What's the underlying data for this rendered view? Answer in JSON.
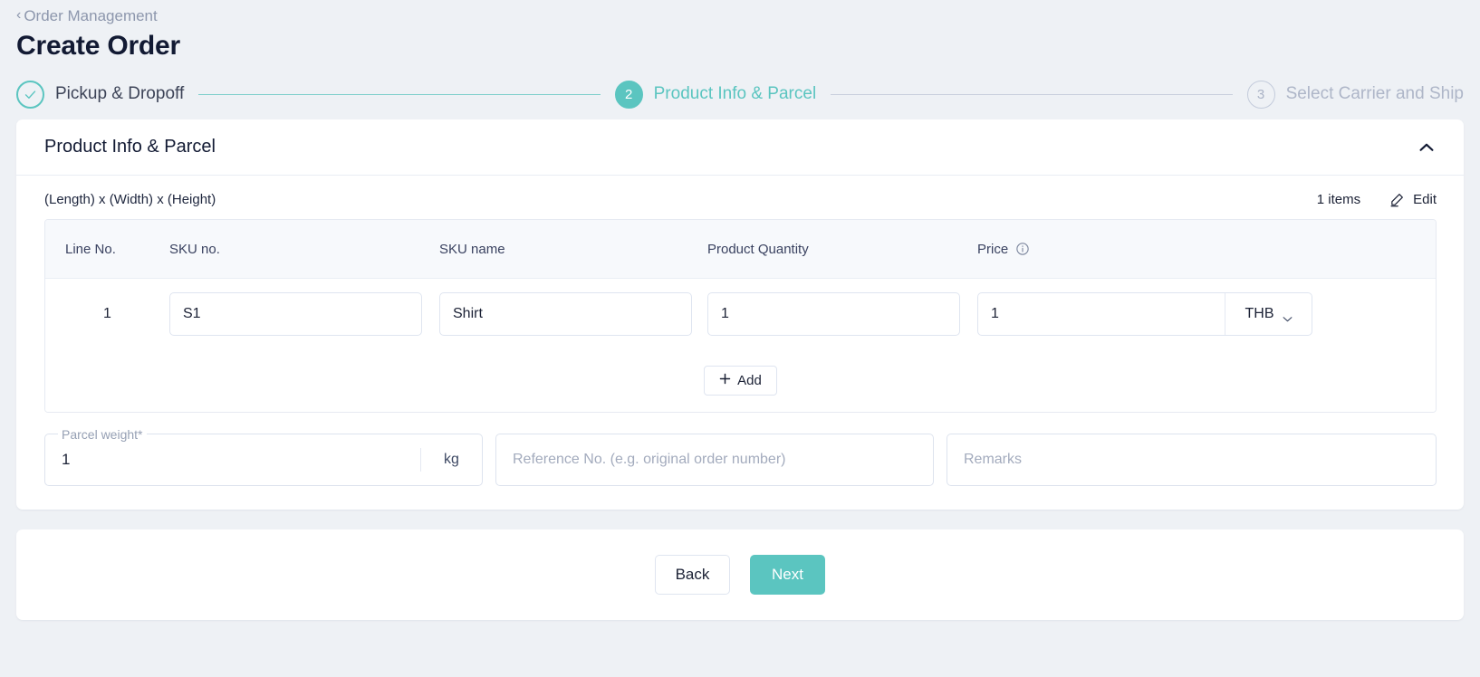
{
  "header": {
    "breadcrumb_label": "Order Management",
    "breadcrumb_icon": "chevron-left-icon",
    "page_title": "Create Order"
  },
  "stepper": {
    "steps": [
      {
        "number": "",
        "label": "Pickup & Dropoff",
        "state": "done",
        "icon": "check-icon"
      },
      {
        "number": "2",
        "label": "Product Info & Parcel",
        "state": "active"
      },
      {
        "number": "3",
        "label": "Select Carrier and Ship",
        "state": "todo"
      }
    ],
    "accent_color": "#5bc5c0",
    "inactive_color": "#aeb6c8"
  },
  "card": {
    "title": "Product Info & Parcel",
    "collapse_icon": "chevron-up-icon",
    "dimensions_label": "(Length) x (Width) x (Height)",
    "items_count": "1 items",
    "edit_label": "Edit",
    "edit_icon": "pencil-icon"
  },
  "table": {
    "columns": [
      "Line No.",
      "SKU no.",
      "SKU name",
      "Product Quantity",
      "Price"
    ],
    "price_info_icon": "info-circle-icon",
    "rows": [
      {
        "line_no": "1",
        "sku_no": "S1",
        "sku_name": "Shirt",
        "quantity": "1",
        "price": "1",
        "currency": "THB",
        "currency_caret_icon": "chevron-down-icon"
      }
    ],
    "add_label": "Add",
    "add_icon": "plus-icon"
  },
  "fields": {
    "parcel_weight": {
      "label": "Parcel weight",
      "required_marker": "*",
      "value": "1",
      "unit": "kg"
    },
    "reference_no": {
      "placeholder": "Reference No. (e.g. original order number)",
      "value": ""
    },
    "remarks": {
      "placeholder": "Remarks",
      "value": ""
    }
  },
  "footer": {
    "back_label": "Back",
    "next_label": "Next",
    "next_color": "#5bc5c0"
  }
}
